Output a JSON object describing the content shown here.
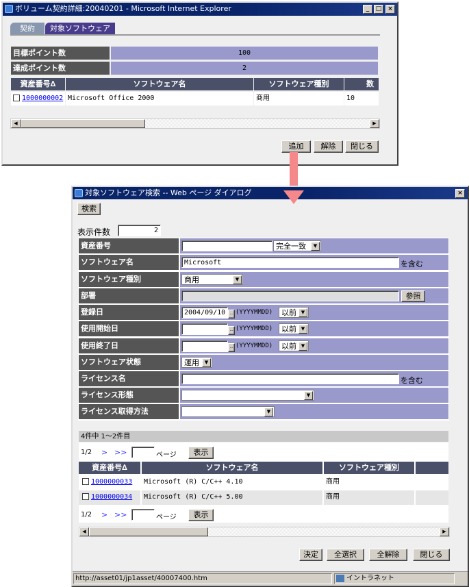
{
  "main_window": {
    "title": "ボリューム契約詳細:20040201 - Microsoft Internet Explorer",
    "tabs": [
      {
        "label": "契約"
      },
      {
        "label": "対象ソフトウェア"
      }
    ],
    "info": [
      {
        "label": "目標ポイント数",
        "value": "100"
      },
      {
        "label": "達成ポイント数",
        "value": "2"
      }
    ],
    "columns": [
      "資産番号∆",
      "ソフトウェア名",
      "ソフトウェア種別",
      "数量"
    ],
    "rows": [
      {
        "asset_no": "1000000002",
        "name": "Microsoft Office 2000",
        "type": "商用",
        "qty": "10"
      }
    ],
    "buttons": {
      "add": "追加",
      "remove": "解除",
      "close": "閉じる"
    }
  },
  "arrow_color": "#f4888a",
  "dialog": {
    "title": "対象ソフトウェア検索 -- Web ページ ダイアログ",
    "search_button": "検索",
    "display_count": {
      "label": "表示件数",
      "value": "2"
    },
    "form": {
      "asset_no": {
        "label": "資産番号",
        "value": "",
        "match": "完全一致"
      },
      "software_name": {
        "label": "ソフトウェア名",
        "value": "Microsoft",
        "suffix": "を含む"
      },
      "software_type": {
        "label": "ソフトウェア種別",
        "value": "商用"
      },
      "department": {
        "label": "部署",
        "value": "",
        "button": "参照"
      },
      "registered": {
        "label": "登録日",
        "value": "2004/09/10",
        "format": "(YYYYMMDD)",
        "cond": "以前"
      },
      "use_start": {
        "label": "使用開始日",
        "value": "",
        "format": "(YYYYMMDD)",
        "cond": "以前"
      },
      "use_end": {
        "label": "使用終了日",
        "value": "",
        "format": "(YYYYMMDD)",
        "cond": "以前"
      },
      "software_status": {
        "label": "ソフトウェア状態",
        "value": "運用"
      },
      "license_name": {
        "label": "ライセンス名",
        "value": "",
        "suffix": "を含む"
      },
      "license_form": {
        "label": "ライセンス形態",
        "value": ""
      },
      "license_method": {
        "label": "ライセンス取得方法",
        "value": ""
      }
    },
    "result_summary": "4件中 1～2件目",
    "pager": {
      "page": "1/2",
      "next": ">",
      "last": ">>",
      "page_label": "ページ",
      "show": "表示"
    },
    "columns": [
      "資産番号∆",
      "ソフトウェア名",
      "ソフトウェア種別"
    ],
    "rows": [
      {
        "asset_no": "1000000033",
        "name": "Microsoft (R) C/C++ 4.10",
        "type": "商用"
      },
      {
        "asset_no": "1000000034",
        "name": "Microsoft (R) C/C++ 5.00",
        "type": "商用"
      }
    ],
    "buttons": {
      "ok": "決定",
      "select_all": "全選択",
      "clear_all": "全解除",
      "close": "閉じる"
    },
    "status": {
      "url": "http://asset01/jp1asset/40007400.htm",
      "zone": "イントラネット"
    }
  }
}
